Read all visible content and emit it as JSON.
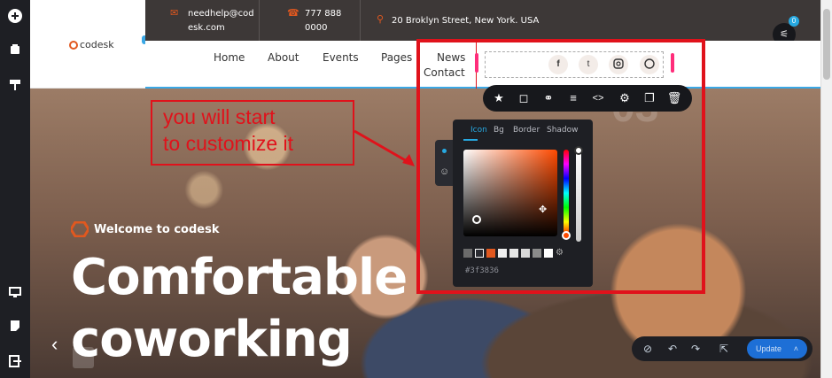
{
  "left_toolbar": {
    "icons": [
      "plus-icon",
      "layers-icon",
      "paint-roller-icon",
      "desktop-icon",
      "note-icon",
      "exit-icon"
    ]
  },
  "header": {
    "logo": "codesk",
    "email_line1": "needhelp@cod",
    "email_line2": "esk.com",
    "phone_line1": "777 888",
    "phone_line2": "0000",
    "address": "20 Broklyn Street, New York. USA",
    "nav": [
      "Home",
      "About",
      "Events",
      "Pages",
      "News",
      "Contact"
    ],
    "badge_count": "0"
  },
  "social_icons": [
    "facebook-icon",
    "twitter-icon",
    "instagram-icon",
    "dribbble-icon"
  ],
  "annotation": {
    "line1": "you will start",
    "line2": "to customize it",
    "color": "#e0121b"
  },
  "element_toolbar": {
    "icons": [
      "star-icon",
      "square-icon",
      "link-icon",
      "align-icon",
      "code-icon",
      "gear-icon",
      "copy-icon",
      "trash-icon"
    ]
  },
  "color_picker": {
    "tabs": [
      "Icon",
      "Bg",
      "Border",
      "Shadow"
    ],
    "active_tab": "Icon",
    "hex_value": "#3f3836",
    "base_color": "#ff4a00",
    "swatches": [
      "#6b6b6b",
      "#2a2b31",
      "#e1581f",
      "#f0f0f0",
      "#e6e6e6",
      "#d8d8d8",
      "#8b8b8b",
      "#ffffff"
    ]
  },
  "hero": {
    "welcome": "Welcome to codesk",
    "headline1": "Comfortable",
    "headline2": "coworking",
    "watermark_top": "03"
  },
  "bottom_toolbar": {
    "update_label": "Update",
    "accent": "#1d6fd6"
  }
}
